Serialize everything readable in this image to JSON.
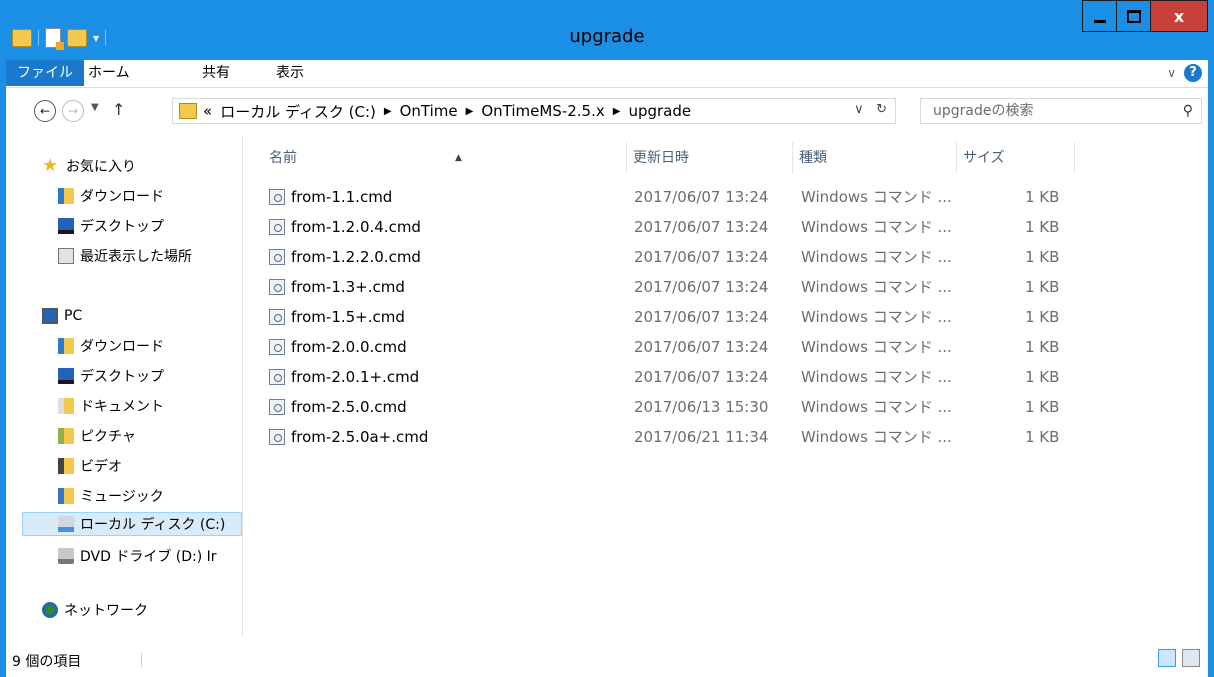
{
  "window": {
    "title": "upgrade",
    "controls": {
      "close_label": "x"
    }
  },
  "ribbon": {
    "tabs": [
      "ファイル",
      "ホーム",
      "共有",
      "表示"
    ]
  },
  "address": {
    "overflow": "«",
    "crumbs": [
      "ローカル ディスク (C:)",
      "OnTime",
      "OnTimeMS-2.5.x",
      "upgrade"
    ],
    "search_placeholder": "upgradeの検索"
  },
  "sidebar": {
    "favorites": {
      "label": "お気に入り",
      "items": [
        "ダウンロード",
        "デスクトップ",
        "最近表示した場所"
      ]
    },
    "pc": {
      "label": "PC",
      "items": [
        "ダウンロード",
        "デスクトップ",
        "ドキュメント",
        "ピクチャ",
        "ビデオ",
        "ミュージック",
        "ローカル ディスク (C:)",
        "DVD ドライブ (D:) Ir"
      ]
    },
    "network": {
      "label": "ネットワーク"
    }
  },
  "columns": {
    "name": "名前",
    "date": "更新日時",
    "type": "種類",
    "size": "サイズ"
  },
  "files": [
    {
      "name": "from-1.1.cmd",
      "date": "2017/06/07 13:24",
      "type": "Windows コマンド ...",
      "size": "1 KB"
    },
    {
      "name": "from-1.2.0.4.cmd",
      "date": "2017/06/07 13:24",
      "type": "Windows コマンド ...",
      "size": "1 KB"
    },
    {
      "name": "from-1.2.2.0.cmd",
      "date": "2017/06/07 13:24",
      "type": "Windows コマンド ...",
      "size": "1 KB"
    },
    {
      "name": "from-1.3+.cmd",
      "date": "2017/06/07 13:24",
      "type": "Windows コマンド ...",
      "size": "1 KB"
    },
    {
      "name": "from-1.5+.cmd",
      "date": "2017/06/07 13:24",
      "type": "Windows コマンド ...",
      "size": "1 KB"
    },
    {
      "name": "from-2.0.0.cmd",
      "date": "2017/06/07 13:24",
      "type": "Windows コマンド ...",
      "size": "1 KB"
    },
    {
      "name": "from-2.0.1+.cmd",
      "date": "2017/06/07 13:24",
      "type": "Windows コマンド ...",
      "size": "1 KB"
    },
    {
      "name": "from-2.5.0.cmd",
      "date": "2017/06/13 15:30",
      "type": "Windows コマンド ...",
      "size": "1 KB"
    },
    {
      "name": "from-2.5.0a+.cmd",
      "date": "2017/06/21 11:34",
      "type": "Windows コマンド ...",
      "size": "1 KB"
    }
  ],
  "status": {
    "item_count": "9 個の項目"
  }
}
